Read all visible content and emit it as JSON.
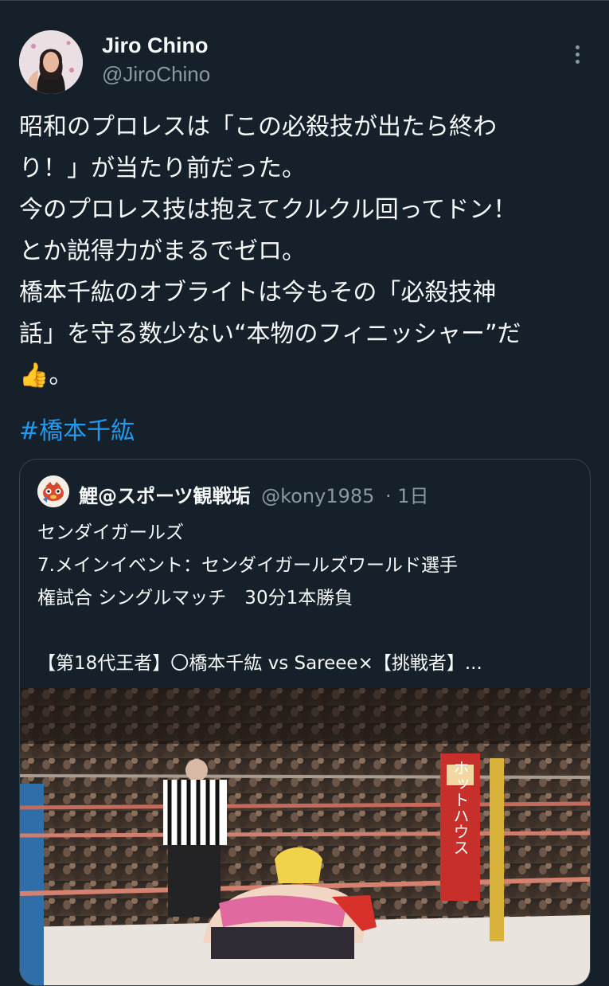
{
  "author": {
    "name": "Jiro Chino",
    "handle": "@JiroChino"
  },
  "tweet": {
    "lines": [
      "昭和のプロレスは「この必殺技が出たら終わ",
      "り！」が当たり前だった。",
      "今のプロレス技は抱えてクルクル回ってドン！",
      "とか説得力がまるでゼロ。",
      "橋本千紘のオブライトは今もその「必殺技神",
      "話」を守る数少ない“本物のフィニッシャー”だ",
      "👍。"
    ],
    "hashtag": "#橋本千紘"
  },
  "quoted": {
    "name": "鯉@スポーツ観戦垢",
    "handle": "@kony1985",
    "time": "· 1日",
    "lines": [
      "センダイガールズ",
      "7.メインイベント：センダイガールズワールド選手",
      "権試合 シングルマッチ　30分1本勝負",
      "",
      "【第18代王者】〇橋本千紘 vs Sareee×【挑戦者】..."
    ],
    "media": {
      "banner_text": "ホットハウス",
      "description_icon": "wrestling-ring-photo"
    }
  },
  "colors": {
    "background": "#15202b",
    "text": "#f7f9f9",
    "secondary": "#8b98a5",
    "link": "#1d9bf0",
    "border": "#38444d"
  },
  "icons": [
    "more-options-icon",
    "avatar",
    "quoted-avatar"
  ]
}
